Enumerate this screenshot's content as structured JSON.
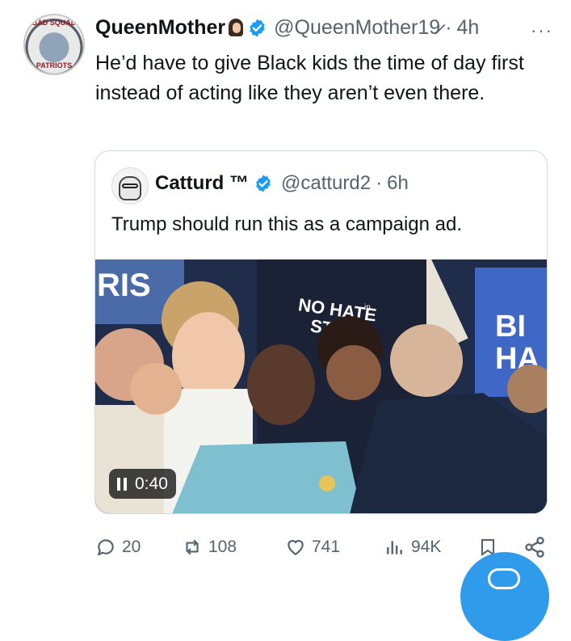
{
  "author": {
    "name": "QueenMother",
    "handle": "@QueenMother19̷",
    "separator": "·",
    "time": "4h",
    "avatar_ring_top": "BAD SQUAD",
    "avatar_ring_bottom": "PATRIOTS",
    "more": "···"
  },
  "tweet": {
    "text": "He’d have to give Black kids the time of day first instead of acting like they aren’t even there."
  },
  "quote": {
    "name": "Catturd ™",
    "handle": "@catturd2",
    "separator": "·",
    "time": "6h",
    "text": "Trump should run this as a campaign ad.",
    "video_time": "0:40",
    "sign_left": "RIS",
    "shirt_text_1": "NO HATE",
    "shirt_text_2": "STATE",
    "shirt_text_small": "in",
    "sign_right_1": "BI",
    "sign_right_2": "HA"
  },
  "actions": {
    "replies": "20",
    "reposts": "108",
    "likes": "741",
    "views": "94K"
  },
  "colors": {
    "verified": "#1d9bf0",
    "muted": "#536471",
    "fab": "#2f9bea"
  }
}
